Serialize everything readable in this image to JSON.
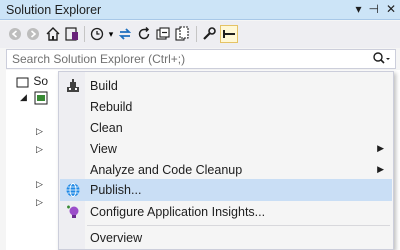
{
  "panel": {
    "title": "Solution Explorer",
    "ctrl_dropdown": "▾",
    "ctrl_pin": "⊣",
    "ctrl_close": "✕"
  },
  "toolbar": {
    "icons": [
      "back-icon",
      "forward-icon",
      "home-icon",
      "switch-views-icon",
      "history-icon",
      "sync-icon",
      "refresh-icon",
      "collapse-all-icon",
      "show-all-files-icon",
      "properties-icon",
      "preview-icon"
    ]
  },
  "search": {
    "placeholder": "Search Solution Explorer (Ctrl+;)",
    "icon_glyph": "⌕"
  },
  "tree": {
    "solution_label": "So"
  },
  "context_menu": {
    "items": [
      {
        "label": "Build",
        "icon": "build-icon"
      },
      {
        "label": "Rebuild"
      },
      {
        "label": "Clean"
      },
      {
        "label": "View",
        "submenu": true
      },
      {
        "label": "Analyze and Code Cleanup",
        "submenu": true
      },
      {
        "label": "Publish...",
        "icon": "publish-globe-icon",
        "highlighted": true
      },
      {
        "label": "Configure Application Insights...",
        "icon": "app-insights-icon"
      },
      {
        "label": "Overview"
      }
    ],
    "submenu_arrow": "▶"
  },
  "colors": {
    "title_bar": "#cce4f7",
    "highlight": "#c9def5"
  }
}
